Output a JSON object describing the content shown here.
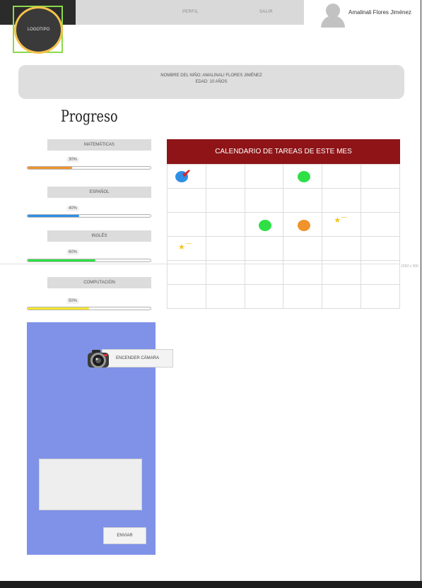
{
  "header": {
    "logo": "LOGOTIPO",
    "nav": [
      "PERFIL",
      "SALIR"
    ],
    "user_name": "Amalinali Flores Jiménez"
  },
  "info": {
    "child_name": "NOMBRE DEL NIÑO: AMALINALI FLORES JIMÉNEZ",
    "age": "EDAD: 10 AÑOS"
  },
  "progress": {
    "title": "Progreso",
    "subjects": [
      {
        "label": "MATEMÁTICAS",
        "percent_text": "30%",
        "value": 0.36,
        "color": "#f0932b"
      },
      {
        "label": "ESPAÑOL",
        "percent_text": "40%",
        "value": 0.42,
        "color": "#2f8fe6"
      },
      {
        "label": "INGLÉS",
        "percent_text": "60%",
        "value": 0.55,
        "color": "#2ee046"
      },
      {
        "label": "COMPUTACIÓN",
        "percent_text": "50%",
        "value": 0.5,
        "color": "#f6e62c"
      }
    ]
  },
  "calendar": {
    "title": "CALENDARIO DE TAREAS DE ESTE MES",
    "colors": {
      "header": "#8e1417",
      "green": "#2ee046",
      "orange": "#f0932b",
      "blue": "#2f8fe6",
      "star": "#f5c518",
      "check": "#e0232a"
    }
  },
  "dimension_label": "1250 x 300",
  "camera": {
    "button": "ENCENDER CÁMARA",
    "send": "ENVIAR",
    "panel_color": "#7f92e8"
  }
}
